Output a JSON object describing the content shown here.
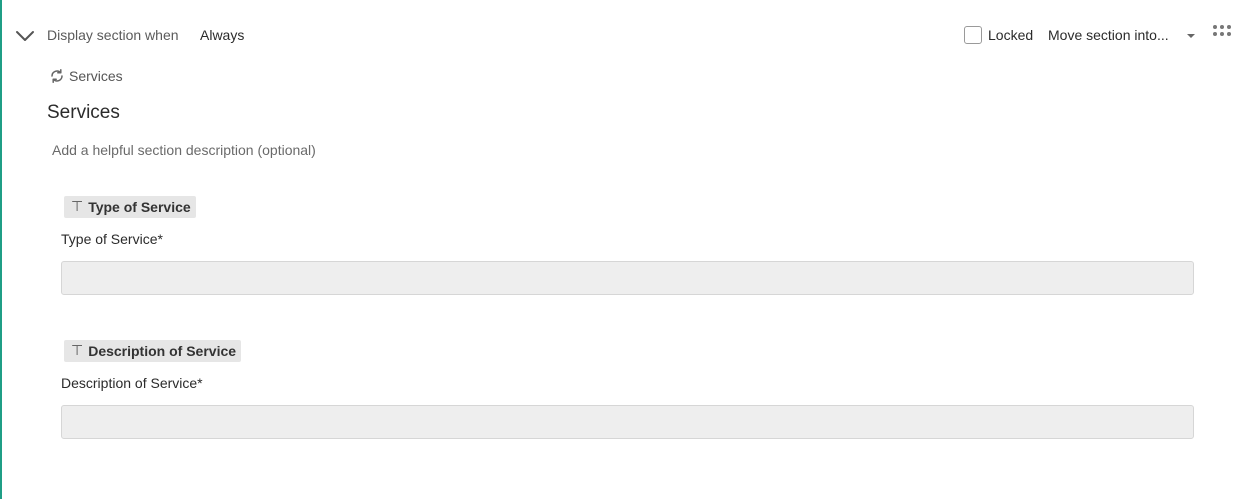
{
  "header": {
    "display_label": "Display section when",
    "display_value": "Always",
    "locked_label": "Locked",
    "locked_checked": false,
    "move_label": "Move section into..."
  },
  "section": {
    "link_label": "Services",
    "title": "Services",
    "description_placeholder": "Add a helpful section description (optional)"
  },
  "fields": [
    {
      "tag": "Type of Service",
      "label": "Type of Service*",
      "value": ""
    },
    {
      "tag": "Description of Service",
      "label": "Description of Service*",
      "value": ""
    }
  ],
  "icons": {
    "collapse": "chevron-down-icon",
    "sync": "sync-icon",
    "text_field": "text-type-icon",
    "drag": "drag-grip-icon",
    "dropdown": "caret-down-icon"
  },
  "colors": {
    "accent": "#1f9e86",
    "tag_bg": "#e6e6e6",
    "input_bg": "#eeeeee"
  }
}
